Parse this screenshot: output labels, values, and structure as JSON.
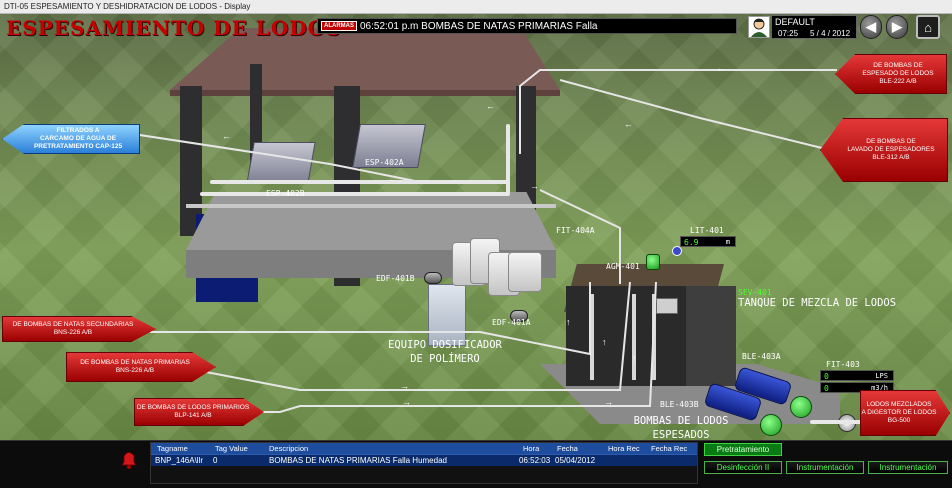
{
  "window": {
    "title": "DTI-05 ESPESAMIENTO Y DESHIDRATACION DE LODOS - Display"
  },
  "header": {
    "title": "ESPESAMIENTO DE LODOS",
    "alarm_badge": "ALARMAS",
    "alarm_message": "06:52:01 p.m BOMBAS DE NATAS PRIMARIAS Falla",
    "user": "DEFAULT",
    "time": "07:25",
    "date": "5 / 4 / 2012",
    "nav": {
      "back": "◀",
      "forward": "▶",
      "home": "⌂"
    }
  },
  "equipment": {
    "esp_402a": "ESP-402A",
    "esp_402b": "ESP-402B",
    "fit_404a": "FIT-404A",
    "lit_401": "LIT-401",
    "lit_value": "6.9",
    "lit_unit": "m",
    "edf_401b": "EDF-401B",
    "edf_401a": "EDF-401A",
    "agm_401": "AGM-401",
    "sev_401": "SEV-401",
    "ble_403a": "BLE-403A",
    "ble_403b": "BLE-403B",
    "fit_403": "FIT-403",
    "fit_value_1": "0",
    "fit_unit_1": "LPS",
    "fit_value_2": "0",
    "fit_unit_2": "m3/h"
  },
  "labels": {
    "tanque": "TANQUE DE MEZCLA DE LODOS",
    "equipo_line1": "EQUIPO DOSIFICADOR",
    "equipo_line2": "DE POLÍMERO",
    "bombas_line1": "BOMBAS DE LODOS",
    "bombas_line2": "ESPESADOS"
  },
  "arrows": {
    "filtrados": [
      "FILTRADOS A",
      "CARCAMO DE AGUA DE",
      "PRETRATAMIENTO CAP-125"
    ],
    "espesado": [
      "DE BOMBAS DE",
      "ESPESADO DE LODOS",
      "BLE-222 A/B"
    ],
    "lavado": [
      "DE BOMBAS DE",
      "LAVADO DE ESPESADORES",
      "BLE-312 A/B"
    ],
    "natas_sec": [
      "DE BOMBAS DE NATAS SECUNDARIAS",
      "BNS-226 A/B"
    ],
    "natas_prim": [
      "DE BOMBAS DE NATAS PRIMARIAS",
      "BNS-226 A/B"
    ],
    "lodos_prim": [
      "DE BOMBAS DE LODOS PRIMARIOS",
      "BLP-141 A/B"
    ],
    "mezclados": [
      "LODOS MEZCLADOS",
      "A DIGESTOR DE LODOS",
      "BG-500"
    ]
  },
  "alarm_table": {
    "columns": [
      "Tagname",
      "Tag Value",
      "Descripcion",
      "Hora",
      "Fecha",
      "Hora Rec",
      "Fecha Rec"
    ],
    "rows": [
      {
        "tagname": "BNP_146A\\llr",
        "value": "0",
        "description": "BOMBAS DE NATAS PRIMARIAS Falla Humedad",
        "hora": "06:52:03",
        "fecha": "05/04/2012",
        "hora_rec": "",
        "fecha_rec": ""
      }
    ]
  },
  "buttons": {
    "pretratamiento": "Pretratamiento",
    "desinfeccion": "Desinfección II",
    "instrumentacion1": "Instrumentación",
    "instrumentacion2": "Instrumentación"
  },
  "colors": {
    "title_red": "#c40000",
    "alarm_red": "#c00000",
    "readout_green": "#4eff2e",
    "table_blue": "#1d4d9c",
    "button_green": "#4cff4c"
  },
  "icons": {
    "alarm_bell": "alarm-bell-icon",
    "user": "user-avatar-icon"
  }
}
